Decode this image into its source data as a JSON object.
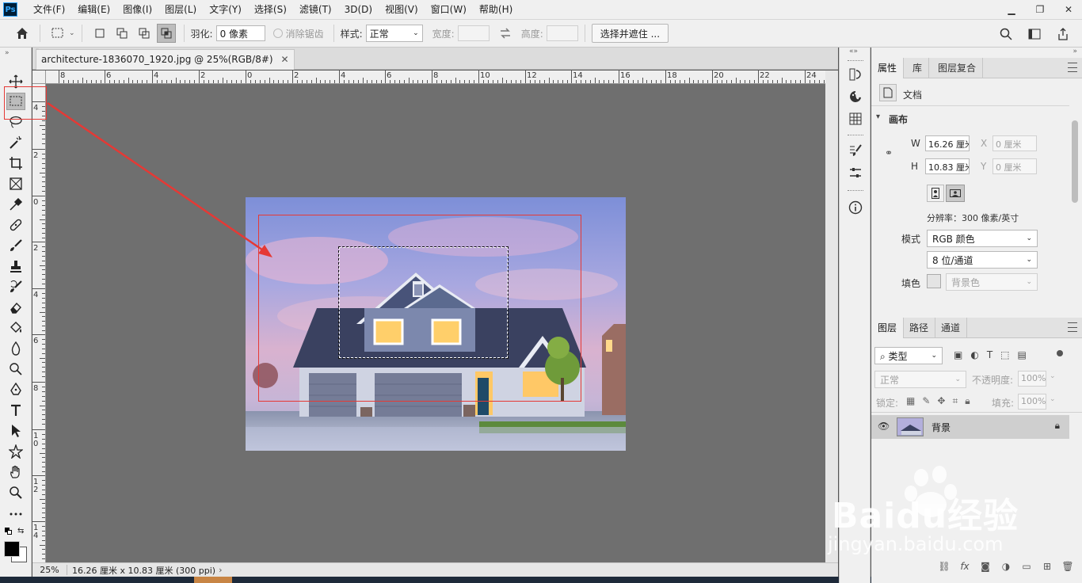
{
  "app": {
    "logo": "Ps"
  },
  "menu": [
    "文件(F)",
    "编辑(E)",
    "图像(I)",
    "图层(L)",
    "文字(Y)",
    "选择(S)",
    "滤镜(T)",
    "3D(D)",
    "视图(V)",
    "窗口(W)",
    "帮助(H)"
  ],
  "options": {
    "feather_label": "羽化:",
    "feather_value": "0 像素",
    "antialias_label": "消除锯齿",
    "style_label": "样式:",
    "style_value": "正常",
    "width_label": "宽度:",
    "height_label": "高度:",
    "select_mask_button": "选择并遮住 ..."
  },
  "document": {
    "tab_title": "architecture-1836070_1920.jpg @ 25%(RGB/8#)",
    "ruler_h": [
      "8",
      "6",
      "4",
      "2",
      "0",
      "2",
      "4",
      "6",
      "8",
      "10",
      "12",
      "14",
      "16",
      "18",
      "20",
      "22",
      "24"
    ],
    "ruler_v": [
      "4",
      "2",
      "0",
      "2",
      "4",
      "6",
      "8",
      "1\n0",
      "1\n2",
      "1\n4"
    ]
  },
  "status": {
    "zoom": "25%",
    "info": "16.26 厘米 x 10.83 厘米 (300 ppi)"
  },
  "properties": {
    "tabs": [
      "属性",
      "库",
      "图层复合"
    ],
    "doc_label": "文档",
    "canvas_section": "画布",
    "w_label": "W",
    "w_value": "16.26 厘米",
    "h_label": "H",
    "h_value": "10.83 厘米",
    "x_label": "X",
    "x_value": "0 厘米",
    "y_label": "Y",
    "y_value": "0 厘米",
    "resolution": "分辨率：300 像素/英寸",
    "mode_label": "模式",
    "mode_value": "RGB 颜色",
    "depth_value": "8 位/通道",
    "fill_label": "填色",
    "fill_value": "背景色"
  },
  "layers": {
    "tabs": [
      "图层",
      "路径",
      "通道"
    ],
    "kind_filter": "类型",
    "blend_mode": "正常",
    "opacity_label": "不透明度:",
    "opacity_value": "100%",
    "lock_label": "锁定:",
    "fill_label": "填充:",
    "fill_value": "100%",
    "layer_name": "背景",
    "bottom_icons": [
      "link-icon",
      "fx-icon",
      "mask-icon",
      "adjustment-icon",
      "group-icon",
      "new-layer-icon",
      "trash-icon"
    ]
  },
  "watermark": {
    "text": "Baidu经验",
    "url": "jingyan.baidu.com"
  },
  "colors": {
    "annotation_red": "#e53935",
    "canvas_bg": "#6f6f6f"
  }
}
